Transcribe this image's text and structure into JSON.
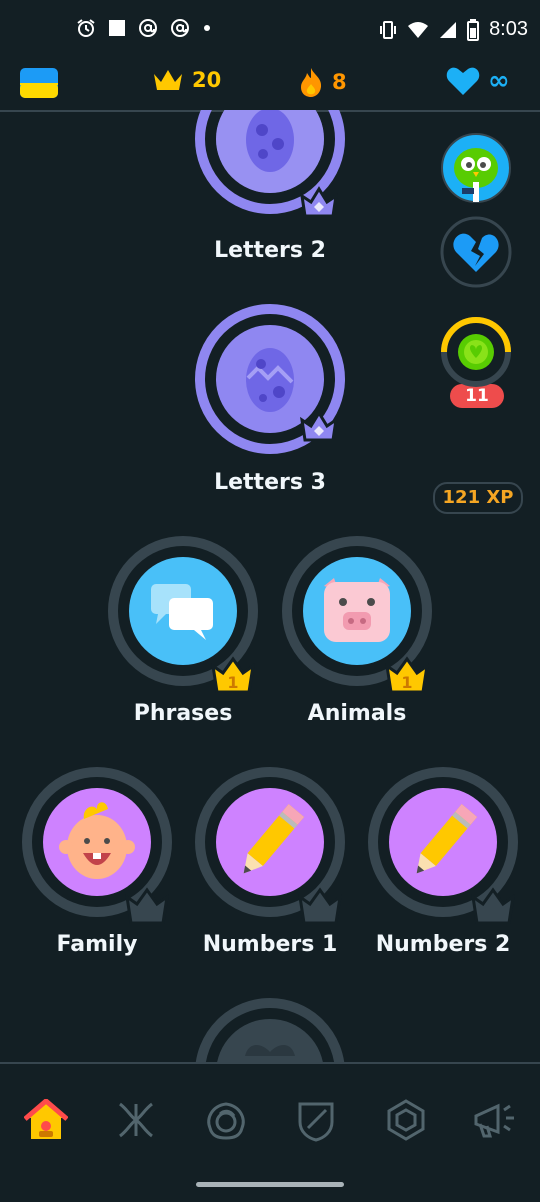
{
  "status_bar": {
    "time": "8:03",
    "left_icons": [
      "alarm-icon",
      "square-icon",
      "at-icon",
      "at-icon",
      "dot-icon"
    ],
    "right_icons": [
      "vibrate-icon",
      "wifi-icon",
      "signal-icon",
      "battery-icon"
    ]
  },
  "top_bar": {
    "flag": "ukraine-flag",
    "crowns": "20",
    "streak": "8",
    "hearts": "∞",
    "colors": {
      "crown": "#ffc800",
      "streak": "#ff9600",
      "heart": "#1cb0f6"
    }
  },
  "skills": [
    {
      "label": "Letters 2",
      "type": "egg",
      "color": "#8f87f1"
    },
    {
      "label": "Letters 3",
      "type": "egg",
      "color": "#8f87f1"
    },
    {
      "label": "Phrases",
      "type": "chat",
      "level": "1",
      "color": "#49c0f8"
    },
    {
      "label": "Animals",
      "type": "pig",
      "level": "1",
      "color": "#49c0f8"
    },
    {
      "label": "Family",
      "type": "baby",
      "color": "#ce82ff"
    },
    {
      "label": "Numbers 1",
      "type": "pencil",
      "color": "#ce82ff"
    },
    {
      "label": "Numbers 2",
      "type": "pencil",
      "color": "#ce82ff"
    }
  ],
  "side": {
    "hearts_badge": "11",
    "xp": "121 XP"
  },
  "nav": [
    "home-icon",
    "alphabet-icon",
    "characters-icon",
    "leagues-icon",
    "shop-icon",
    "news-icon"
  ]
}
